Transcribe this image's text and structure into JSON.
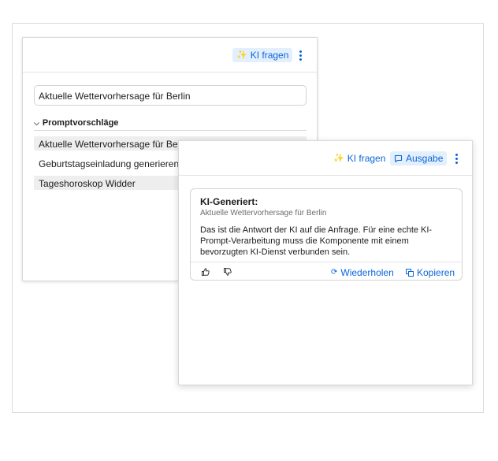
{
  "back_panel": {
    "toolbar": {
      "ask_ai_label": "KI fragen"
    },
    "search": {
      "value": "Aktuelle Wettervorhersage für Berlin"
    },
    "suggestions_header": "Promptvorschläge",
    "suggestions": [
      "Aktuelle Wettervorhersage für Berlin",
      "Geburtstagseinladung generieren",
      "Tageshoroskop Widder"
    ]
  },
  "front_panel": {
    "toolbar": {
      "ask_ai_label": "KI fragen",
      "output_label": "Ausgabe"
    },
    "card": {
      "title": "KI-Generiert:",
      "prompt": "Aktuelle Wettervorhersage für Berlin",
      "body": "Das ist die Antwort der KI auf die Anfrage. Für eine echte KI-Prompt-Verarbeitung muss die Komponente mit einem bevorzugten KI-Dienst verbunden sein.",
      "retry_label": "Wiederholen",
      "copy_label": "Kopieren"
    }
  },
  "icons": {
    "ask_ai": "sparkle-icon",
    "output": "speech-bubble-icon",
    "more": "more-vertical-icon",
    "collapse": "chevron-down-icon",
    "like": "thumbs-up-icon",
    "dislike": "thumbs-down-icon",
    "retry": "refresh-icon",
    "copy": "copy-icon"
  },
  "colors": {
    "accent": "#0a66d8",
    "active_bg": "#e4effd"
  }
}
